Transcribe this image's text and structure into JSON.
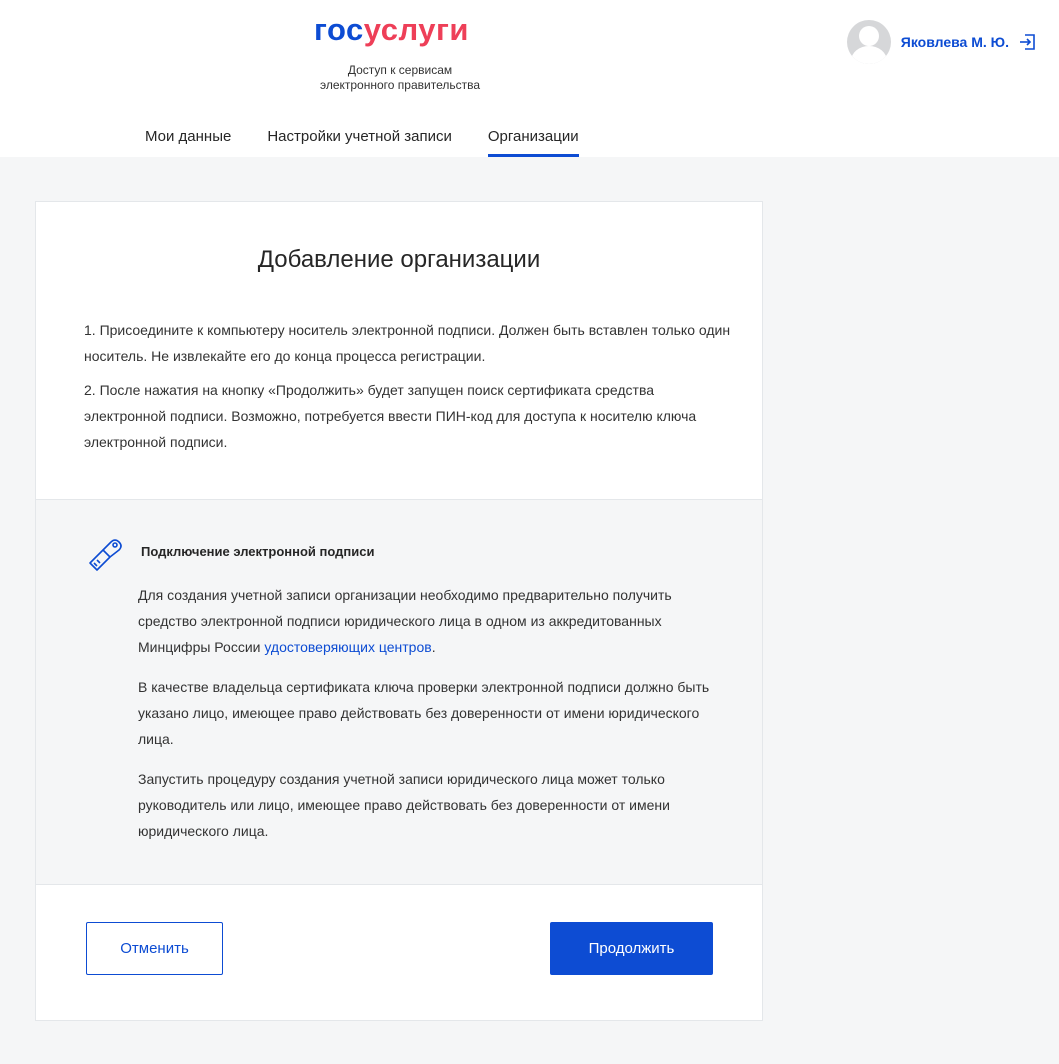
{
  "header": {
    "logo_part1": "гос",
    "logo_part2": "услуги",
    "tagline_line1": "Доступ к сервисам",
    "tagline_line2": "электронного правительства",
    "user_name": "Яковлева М. Ю."
  },
  "tabs": [
    {
      "label": "Мои данные",
      "active": false
    },
    {
      "label": "Настройки учетной записи",
      "active": false
    },
    {
      "label": "Организации",
      "active": true
    }
  ],
  "card": {
    "title": "Добавление организации",
    "step1": "1. Присоедините к компьютеру носитель электронной подписи. Должен быть вставлен только один носитель. Не извлекайте его до конца процесса регистрации.",
    "step2": "2. После нажатия на кнопку «Продолжить» будет запущен поиск сертификата средства электронной подписи. Возможно, потребуется ввести ПИН-код для доступа к носителю ключа электронной подписи.",
    "info": {
      "title": "Подключение электронной подписи",
      "para1_text": "Для создания учетной записи организации необходимо предварительно получить средство электронной подписи юридического лица в одном из аккредитованных Минцифры России ",
      "para1_link": "удостоверяющих центров",
      "para1_end": ".",
      "para2": "В качестве владельца сертификата ключа проверки электронной подписи должно быть указано лицо, имеющее право действовать без доверенности от имени юридического лица.",
      "para3": "Запустить процедуру создания учетной записи юридического лица может только руководитель или лицо, имеющее право действовать без доверенности от имени юридического лица."
    },
    "cancel_label": "Отменить",
    "continue_label": "Продолжить"
  },
  "colors": {
    "brand_blue": "#0d4cd3",
    "brand_red": "#ee3f58",
    "page_bg": "#f5f6f7"
  }
}
